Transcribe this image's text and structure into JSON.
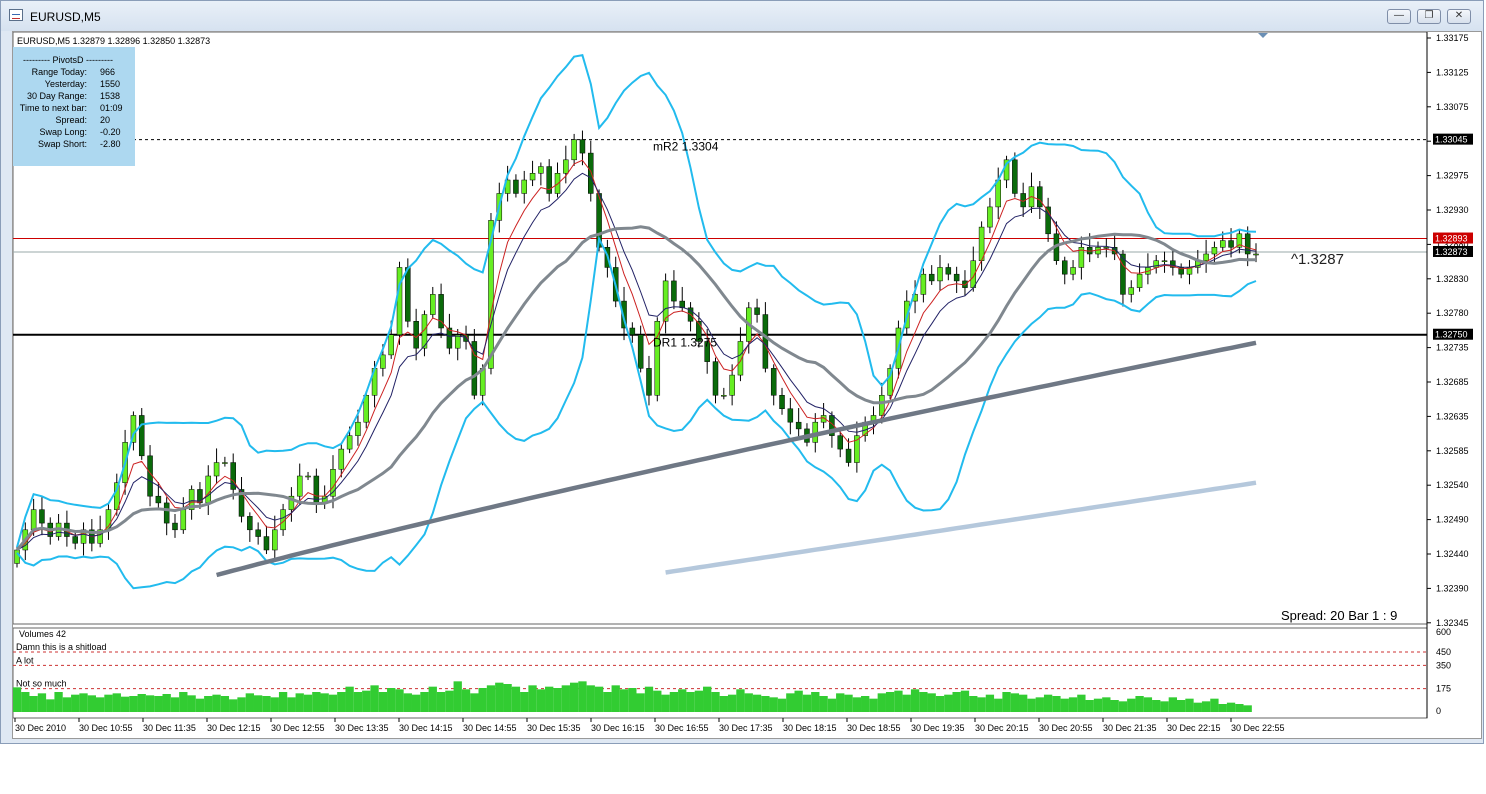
{
  "window": {
    "title": "EURUSD,M5",
    "buttons": [
      "minimize",
      "restore",
      "close"
    ]
  },
  "chart_header": "EURUSD,M5  1.32879 1.32896 1.32850 1.32873",
  "pivots": {
    "title": "---------  PivotsD  ---------",
    "rows": [
      {
        "label": "Range  Today:",
        "value": "966"
      },
      {
        "label": "Yesterday:",
        "value": "1550"
      },
      {
        "label": "30 Day Range:",
        "value": "1538"
      },
      {
        "label": "Time to next bar:",
        "value": "01:09"
      },
      {
        "label": "Spread:",
        "value": "20"
      },
      {
        "label": "Swap  Long:",
        "value": "-0.20"
      },
      {
        "label": "Swap  Short:",
        "value": "-2.80"
      }
    ]
  },
  "price_axis": [
    "1.33175",
    "1.33125",
    "1.33075",
    "1.33025",
    "1.32975",
    "1.32930",
    "1.32880",
    "1.32830",
    "1.32780",
    "1.32735",
    "1.32685",
    "1.32635",
    "1.32585",
    "1.32540",
    "1.32490",
    "1.32440",
    "1.32390",
    "1.32345"
  ],
  "price_tags": [
    {
      "text": "1.33045",
      "color": "#000000"
    },
    {
      "text": "1.32893",
      "color": "#cc0000"
    },
    {
      "text": "1.32873",
      "color": "#000000"
    },
    {
      "text": "1.32750",
      "color": "#000000"
    }
  ],
  "levels": {
    "mr2": "mR2   1.3304",
    "dr1": "DR1   1.3275",
    "current_price": "^1.3287",
    "spread_bar": "Spread: 20     Bar  1 :   9"
  },
  "volume_panel": {
    "title": "Volumes 42",
    "labels": [
      "Damn this is a shitload",
      "A lot",
      "Not so much"
    ],
    "axis": [
      "600",
      "450",
      "350",
      "175",
      "0"
    ]
  },
  "time_axis": [
    "30 Dec 2010",
    "30 Dec 10:55",
    "30 Dec 11:35",
    "30 Dec 12:15",
    "30 Dec 12:55",
    "30 Dec 13:35",
    "30 Dec 14:15",
    "30 Dec 14:55",
    "30 Dec 15:35",
    "30 Dec 16:15",
    "30 Dec 16:55",
    "30 Dec 17:35",
    "30 Dec 18:15",
    "30 Dec 18:55",
    "30 Dec 19:35",
    "30 Dec 20:15",
    "30 Dec 20:55",
    "30 Dec 21:35",
    "30 Dec 22:15",
    "30 Dec 22:55"
  ],
  "colors": {
    "bull_candle": "#66ee22",
    "bear_candle": "#0a6a0a",
    "volume": "#32cc32",
    "bollinger": "#22bbee",
    "ma_slow_dark": "#6f7885",
    "ma_slow_light": "#b5c8dc",
    "ask_line": "#cc0000",
    "info_box": "#add8f0"
  },
  "chart_data": {
    "type": "candlestick",
    "symbol": "EURUSD",
    "timeframe": "M5",
    "ylim": [
      1.3232,
      1.332
    ],
    "closes": [
      1.3243,
      1.3246,
      1.3249,
      1.3247,
      1.3245,
      1.3247,
      1.3245,
      1.3244,
      1.3246,
      1.3244,
      1.3246,
      1.3249,
      1.3253,
      1.3259,
      1.3263,
      1.3257,
      1.3251,
      1.325,
      1.3247,
      1.3246,
      1.3249,
      1.3252,
      1.325,
      1.3254,
      1.3256,
      1.3256,
      1.3252,
      1.3248,
      1.3246,
      1.3245,
      1.3243,
      1.3246,
      1.3249,
      1.3251,
      1.3254,
      1.3254,
      1.325,
      1.3251,
      1.3255,
      1.3258,
      1.326,
      1.3262,
      1.3266,
      1.327,
      1.3272,
      1.3275,
      1.3285,
      1.3277,
      1.3273,
      1.3278,
      1.3281,
      1.3276,
      1.3273,
      1.3275,
      1.3274,
      1.3266,
      1.327,
      1.3292,
      1.3296,
      1.3298,
      1.3296,
      1.3298,
      1.3299,
      1.33,
      1.3296,
      1.3299,
      1.3301,
      1.3304,
      1.3302,
      1.3296,
      1.3288,
      1.3285,
      1.328,
      1.3276,
      1.3275,
      1.327,
      1.3266,
      1.3277,
      1.3283,
      1.328,
      1.3279,
      1.3277,
      1.3274,
      1.3271,
      1.3266,
      1.3266,
      1.3269,
      1.3274,
      1.3279,
      1.3278,
      1.327,
      1.3266,
      1.3264,
      1.3262,
      1.3261,
      1.3259,
      1.3262,
      1.3263,
      1.326,
      1.3258,
      1.3256,
      1.326,
      1.3262,
      1.3263,
      1.3266,
      1.327,
      1.3276,
      1.328,
      1.3281,
      1.3284,
      1.3283,
      1.3285,
      1.3284,
      1.3283,
      1.3282,
      1.3286,
      1.3291,
      1.3294,
      1.3298,
      1.3301,
      1.3296,
      1.3294,
      1.3297,
      1.3294,
      1.329,
      1.3286,
      1.3284,
      1.3285,
      1.3288,
      1.3287,
      1.3288,
      1.3288,
      1.3287,
      1.3281,
      1.3282,
      1.3284,
      1.3285,
      1.3286,
      1.3286,
      1.3285,
      1.3284,
      1.3285,
      1.3286,
      1.3287,
      1.3288,
      1.3289,
      1.3288,
      1.329,
      1.3287,
      1.3287
    ],
    "volumes": [
      185,
      150,
      120,
      140,
      95,
      150,
      110,
      130,
      140,
      125,
      110,
      130,
      140,
      115,
      120,
      135,
      125,
      120,
      135,
      110,
      150,
      125,
      100,
      120,
      130,
      120,
      95,
      110,
      140,
      125,
      120,
      110,
      150,
      110,
      140,
      130,
      150,
      140,
      130,
      150,
      190,
      150,
      160,
      200,
      150,
      180,
      170,
      140,
      130,
      150,
      190,
      150,
      160,
      230,
      170,
      140,
      180,
      200,
      220,
      210,
      190,
      150,
      200,
      170,
      190,
      180,
      200,
      220,
      230,
      200,
      190,
      150,
      200,
      170,
      180,
      140,
      190,
      160,
      130,
      150,
      170,
      150,
      160,
      190,
      150,
      120,
      130,
      170,
      140,
      130,
      120,
      110,
      100,
      140,
      160,
      130,
      150,
      120,
      100,
      140,
      130,
      110,
      120,
      100,
      140,
      150,
      160,
      130,
      170,
      150,
      140,
      120,
      130,
      150,
      160,
      120,
      110,
      130,
      100,
      150,
      140,
      130,
      100,
      110,
      130,
      120,
      100,
      110,
      130,
      90,
      100,
      110,
      90,
      80,
      100,
      120,
      110,
      90,
      80,
      110,
      90,
      100,
      70,
      80,
      100,
      60,
      70,
      60,
      50
    ],
    "indicators": [
      "Bollinger Bands",
      "Moving Averages",
      "Volumes"
    ]
  }
}
